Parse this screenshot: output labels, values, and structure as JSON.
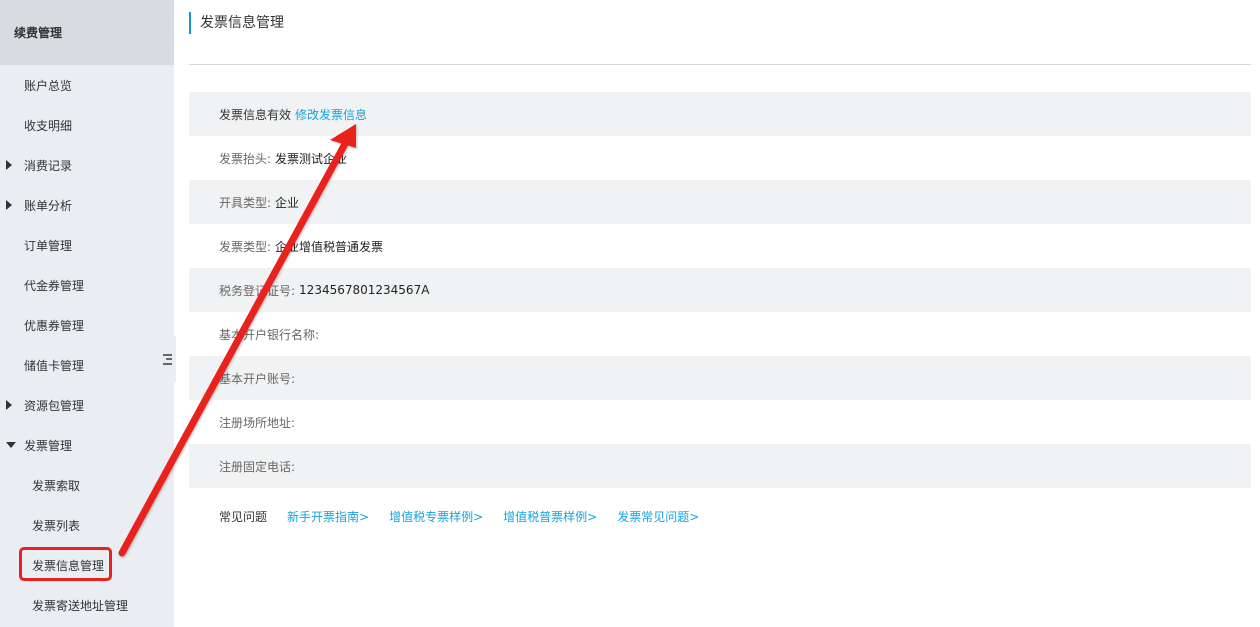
{
  "sidebar": {
    "header": "续费管理",
    "items": [
      {
        "label": "账户总览",
        "arrow": "none",
        "sub": false
      },
      {
        "label": "收支明细",
        "arrow": "none",
        "sub": false
      },
      {
        "label": "消费记录",
        "arrow": "right",
        "sub": false
      },
      {
        "label": "账单分析",
        "arrow": "right",
        "sub": false
      },
      {
        "label": "订单管理",
        "arrow": "none",
        "sub": false
      },
      {
        "label": "代金券管理",
        "arrow": "none",
        "sub": false
      },
      {
        "label": "优惠券管理",
        "arrow": "none",
        "sub": false
      },
      {
        "label": "储值卡管理",
        "arrow": "none",
        "sub": false
      },
      {
        "label": "资源包管理",
        "arrow": "right",
        "sub": false
      },
      {
        "label": "发票管理",
        "arrow": "down",
        "sub": false
      },
      {
        "label": "发票索取",
        "arrow": "none",
        "sub": true
      },
      {
        "label": "发票列表",
        "arrow": "none",
        "sub": true
      },
      {
        "label": "发票信息管理",
        "arrow": "none",
        "sub": true,
        "active": true
      },
      {
        "label": "发票寄送地址管理",
        "arrow": "none",
        "sub": true
      }
    ]
  },
  "main": {
    "title": "发票信息管理",
    "status_text": "发票信息有效",
    "edit_link": "修改发票信息",
    "fields": [
      {
        "label": "发票抬头:",
        "value": "发票测试企业"
      },
      {
        "label": "开具类型:",
        "value": "企业"
      },
      {
        "label": "发票类型:",
        "value": "企业增值税普通发票"
      },
      {
        "label": "税务登记证号:",
        "value": "1234567801234567A"
      },
      {
        "label": "基本开户银行名称:",
        "value": ""
      },
      {
        "label": "基本开户账号:",
        "value": ""
      },
      {
        "label": "注册场所地址:",
        "value": ""
      },
      {
        "label": "注册固定电话:",
        "value": ""
      }
    ],
    "faq": {
      "label": "常见问题",
      "links": [
        "新手开票指南>",
        "增值税专票样例>",
        "增值税普票样例>",
        "发票常见问题>"
      ]
    }
  },
  "colors": {
    "sidebar_bg": "#eaedf1",
    "sidebar_header_bg": "#d8dce1",
    "accent": "#1e90d6",
    "link": "#17a3dd",
    "annotation": "#e8211c"
  },
  "icons": {
    "collapse_toggle": "menu-collapse-icon",
    "expand": "triangle-right-icon",
    "expanded": "triangle-down-icon"
  }
}
